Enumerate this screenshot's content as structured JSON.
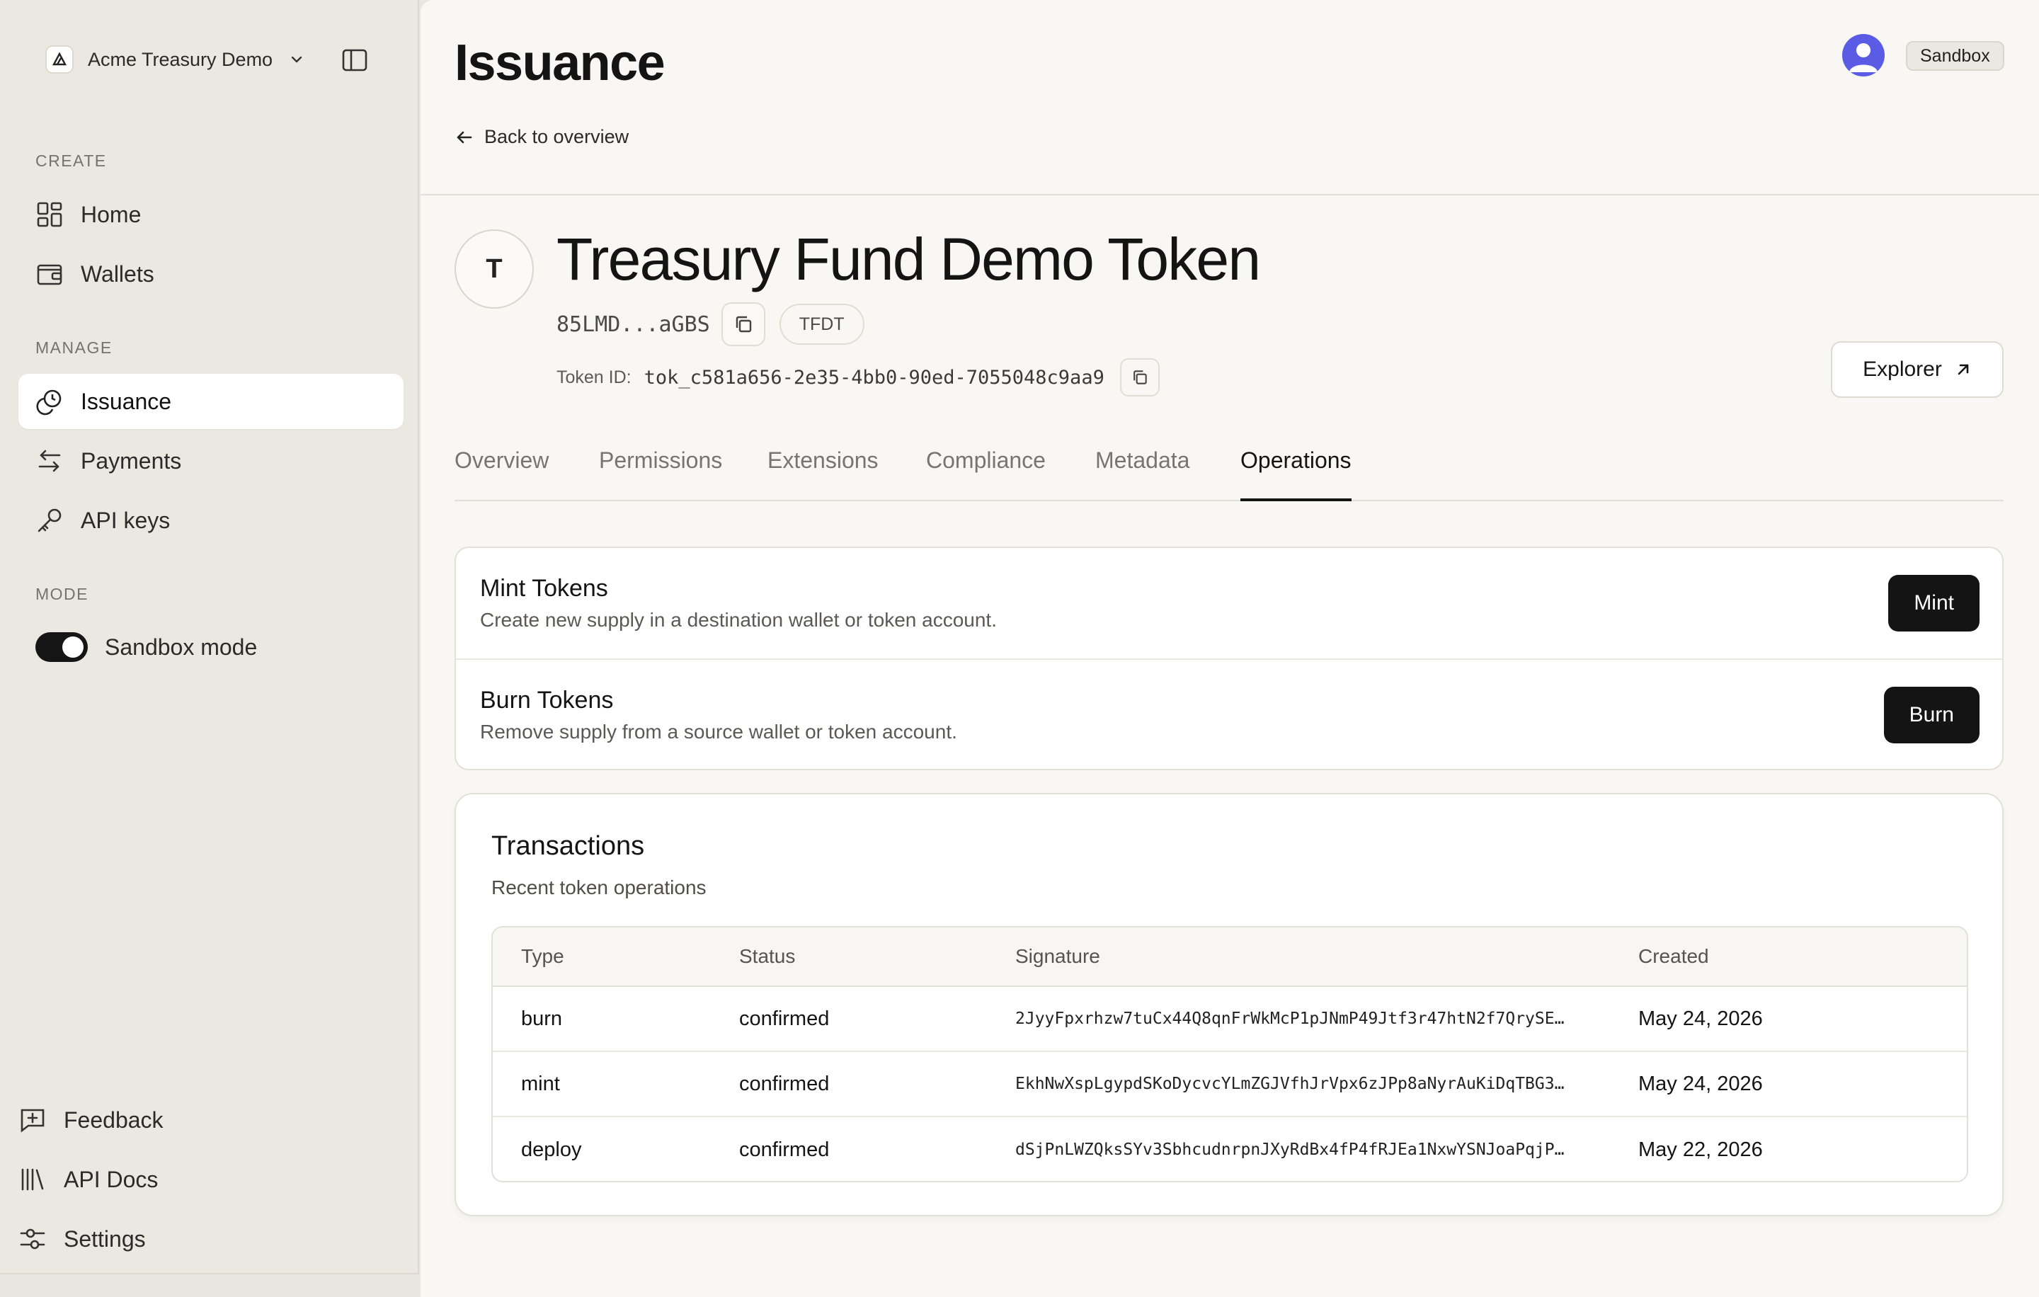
{
  "sidebar": {
    "org_name": "Acme Treasury Demo",
    "sections": {
      "create": "CREATE",
      "manage": "MANAGE",
      "mode": "MODE"
    },
    "items": {
      "home": "Home",
      "wallets": "Wallets",
      "issuance": "Issuance",
      "payments": "Payments",
      "api_keys": "API keys"
    },
    "sandbox_mode": "Sandbox mode",
    "footer": {
      "feedback": "Feedback",
      "api_docs": "API Docs",
      "settings": "Settings"
    }
  },
  "header": {
    "title": "Issuance",
    "back_link": "Back to overview",
    "environment_badge": "Sandbox"
  },
  "token": {
    "avatar_letter": "T",
    "name": "Treasury Fund Demo Token",
    "address_short": "85LMD...aGBS",
    "symbol": "TFDT",
    "id_label": "Token ID:",
    "id_value": "tok_c581a656-2e35-4bb0-90ed-7055048c9aa9",
    "explorer_label": "Explorer"
  },
  "tabs": [
    {
      "label": "Overview"
    },
    {
      "label": "Permissions"
    },
    {
      "label": "Extensions"
    },
    {
      "label": "Compliance"
    },
    {
      "label": "Metadata"
    },
    {
      "label": "Operations",
      "active": true
    }
  ],
  "operations": {
    "mint": {
      "title": "Mint Tokens",
      "description": "Create new supply in a destination wallet or token account.",
      "button": "Mint"
    },
    "burn": {
      "title": "Burn Tokens",
      "description": "Remove supply from a source wallet or token account.",
      "button": "Burn"
    }
  },
  "transactions": {
    "title": "Transactions",
    "subtitle": "Recent token operations",
    "columns": {
      "type": "Type",
      "status": "Status",
      "signature": "Signature",
      "created": "Created"
    },
    "rows": [
      {
        "type": "burn",
        "status": "confirmed",
        "signature": "2JyyFpxrhzw7tuCx44Q8qnFrWkMcP1pJNmP49Jtf3r47htN2f7QrySE…",
        "created": "May 24, 2026"
      },
      {
        "type": "mint",
        "status": "confirmed",
        "signature": "EkhNwXspLgypdSKoDycvcYLmZGJVfhJrVpx6zJPp8aNyrAuKiDqTBG3…",
        "created": "May 24, 2026"
      },
      {
        "type": "deploy",
        "status": "confirmed",
        "signature": "dSjPnLWZQksSYv3SbhcudnrpnJXyRdBx4fP4fRJEa1NxwYSNJoaPqjP…",
        "created": "May 22, 2026"
      }
    ]
  },
  "colors": {
    "sidebar_bg": "#ebe8e1",
    "main_bg": "#f8f7f4",
    "primary_button": "#141414",
    "avatar": "#5b5ce6"
  }
}
